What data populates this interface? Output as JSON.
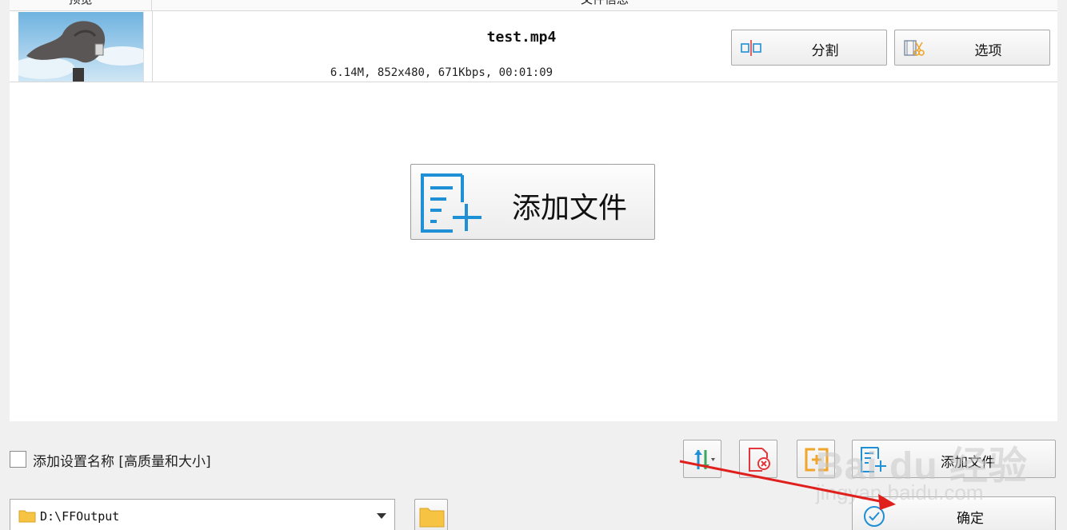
{
  "list": {
    "header": {
      "preview": "预览",
      "info": "文件信息"
    },
    "file": {
      "name": "test.mp4",
      "meta": "6.14M, 852x480, 671Kbps, 00:01:09"
    },
    "split_label": "分割",
    "options_label": "选项",
    "big_add_label": "添加文件"
  },
  "bottom": {
    "checkbox_label": "添加设置名称 [高质量和大小]",
    "checkbox_checked": false,
    "add_file_label": "添加文件",
    "output_path": "D:\\FFOutput",
    "ok_label": "确定"
  },
  "icons": {
    "split": "split-icon",
    "options": "scissors-film-icon",
    "add_file": "add-file-icon",
    "sort": "sort-arrows-icon",
    "clear": "clear-list-icon",
    "merge": "merge-icon",
    "folder": "folder-icon",
    "ok": "check-circle-icon"
  },
  "colors": {
    "accent_blue": "#1f8fd6",
    "folder_yellow": "#f6c343",
    "clear_red": "#e2363b",
    "annotation_red": "#e0201d"
  },
  "watermark": {
    "brand": "Bai du 经验",
    "url": "jingyan.baidu.com"
  }
}
